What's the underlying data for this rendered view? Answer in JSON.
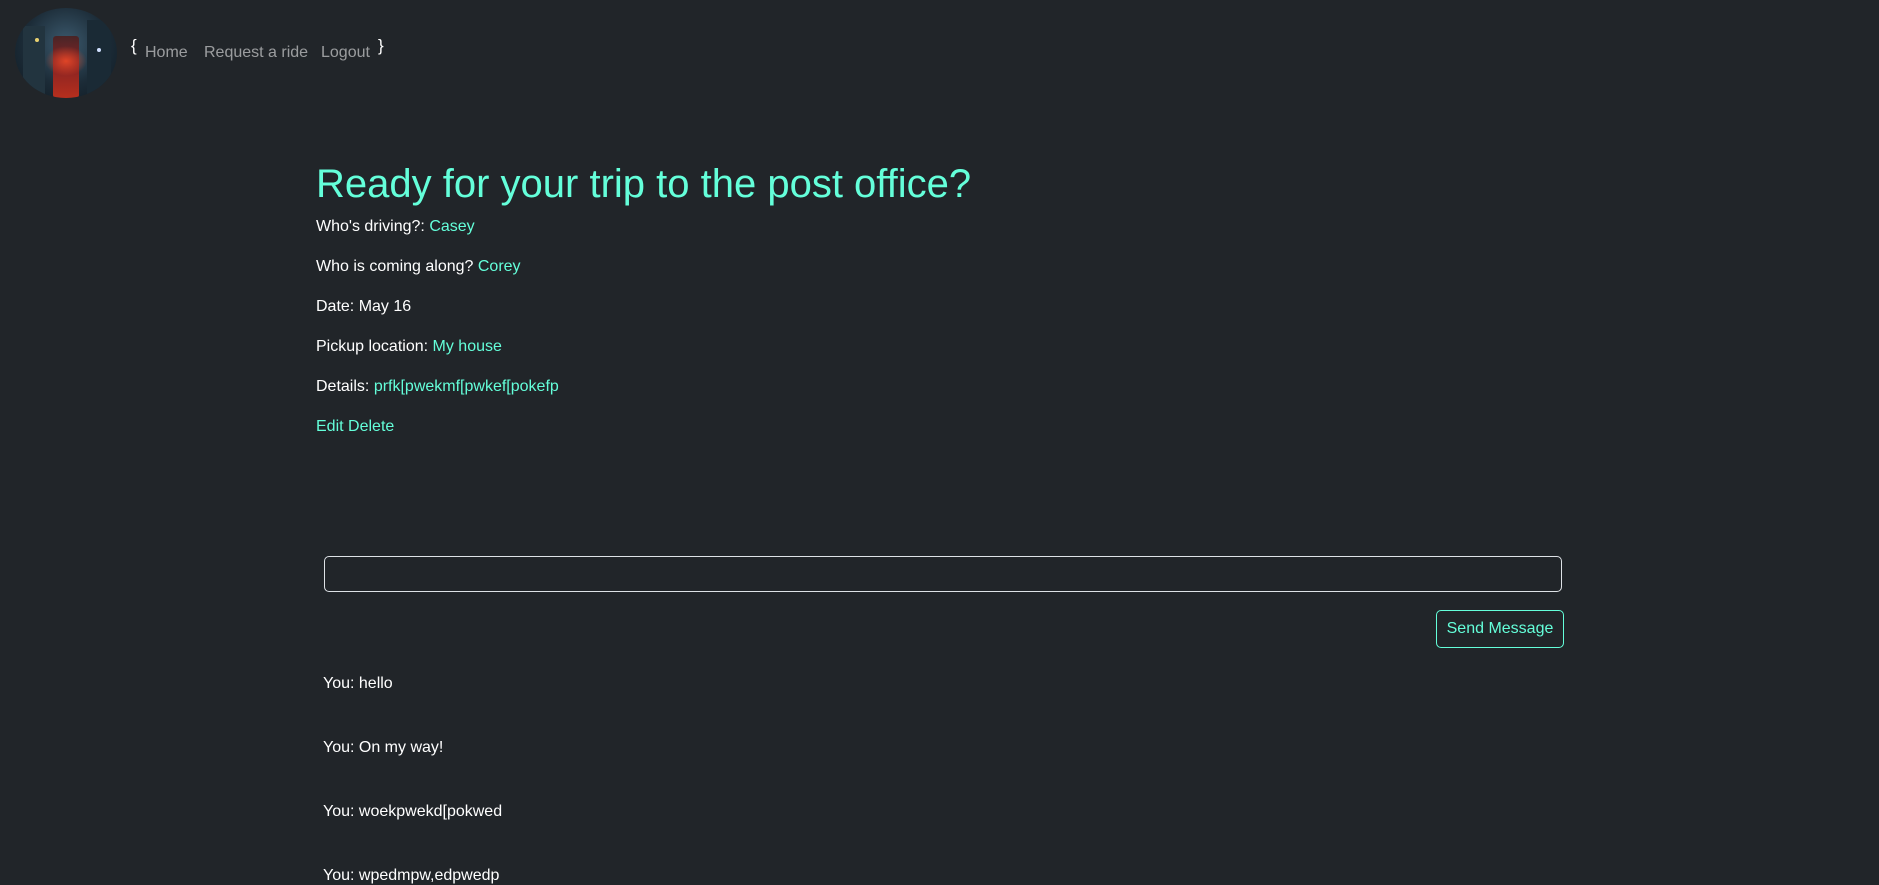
{
  "nav": {
    "open_brace": "{",
    "close_brace": "}",
    "links": [
      {
        "label": "Home"
      },
      {
        "label": "Request a ride"
      },
      {
        "label": "Logout"
      }
    ]
  },
  "trip": {
    "title": "Ready for your trip to the post office?",
    "driver_label": "Who's driving?:",
    "driver": "Casey",
    "companion_label": "Who is coming along?",
    "companion": "Corey",
    "date_label": "Date:",
    "date": "May 16",
    "pickup_label": "Pickup location:",
    "pickup": "My house",
    "details_label": "Details:",
    "details": "prfk[pwekmf[pwkef[pokefp",
    "edit_label": "Edit",
    "delete_label": "Delete"
  },
  "chat": {
    "input_value": "",
    "send_label": "Send Message",
    "messages": [
      {
        "text": "You: hello"
      },
      {
        "text": "You: On my way!"
      },
      {
        "text": "You: woekpwekd[pokwed"
      },
      {
        "text": "You: wpedmpw,edpwedp"
      }
    ]
  },
  "colors": {
    "background": "#212529",
    "accent": "#64ffda",
    "text": "#ffffff",
    "nav_link": "rgba(255,255,255,0.55)"
  }
}
